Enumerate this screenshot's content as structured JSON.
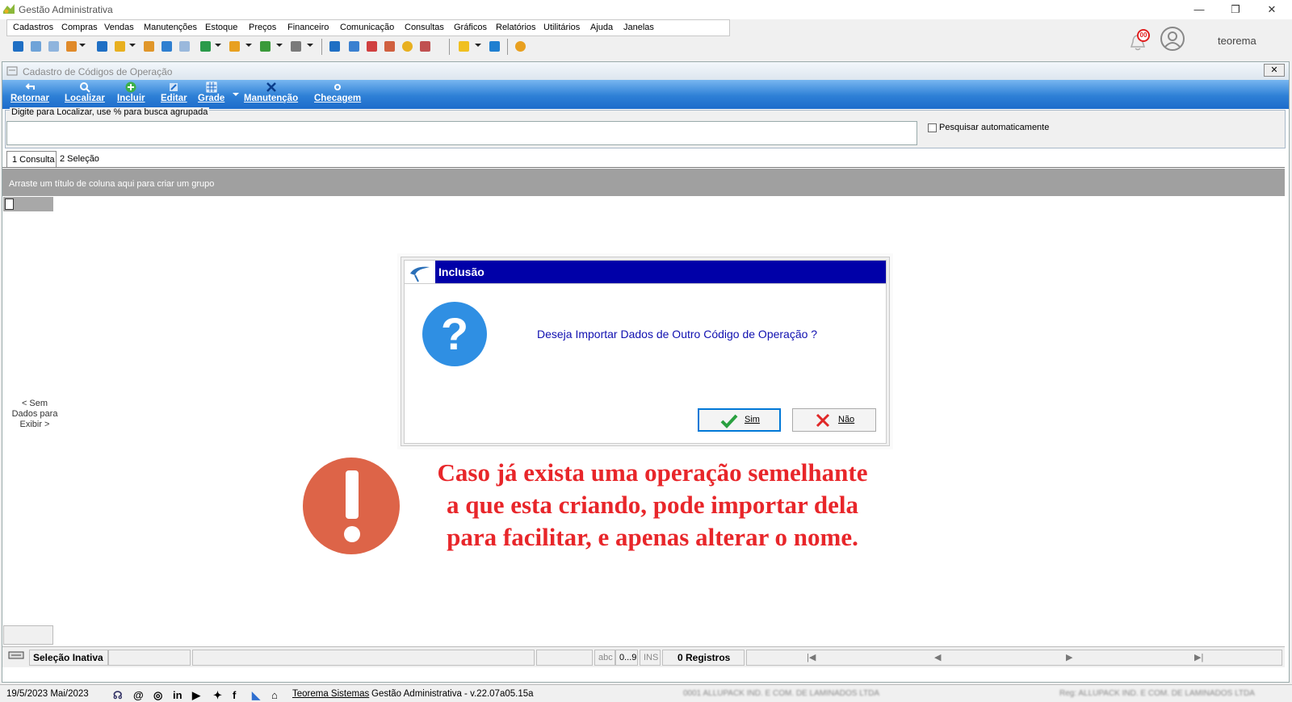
{
  "window": {
    "title": "Gestão Administrativa",
    "controls": {
      "minimize": "—",
      "restore": "❐",
      "close": "✕"
    }
  },
  "menu": [
    "Cadastros",
    "Compras",
    "Vendas",
    "Manutenções",
    "Estoque",
    "Preços",
    "Financeiro",
    "Comunicação",
    "Consultas",
    "Gráficos",
    "Relatórios",
    "Utilitários",
    "Ajuda",
    "Janelas"
  ],
  "header": {
    "notification_count": "00",
    "username": "teorema"
  },
  "form": {
    "title": "Cadastro de Códigos de Operação",
    "close": "✕",
    "ribbon": [
      "Retornar",
      "Localizar",
      "Incluir",
      "Editar",
      "Grade",
      "Manutenção",
      "Checagem"
    ],
    "search_legend": "Digite para Localizar, use % para busca agrupada",
    "search_value": "",
    "auto_search_label": "Pesquisar automaticamente",
    "tabs": [
      "1 Consulta",
      "2 Seleção"
    ],
    "group_hint": "Arraste um título de coluna aqui para criar um grupo",
    "no_data": "< Sem Dados para Exibir >"
  },
  "statusbar": {
    "selection": "Seleção Inativa",
    "abc": "abc",
    "digits": "0...9",
    "ins": "INS",
    "records": "0 Registros",
    "nav": [
      "|◀",
      "◀",
      "▶",
      "▶|"
    ]
  },
  "bottombar": {
    "date": "19/5/2023 Mai/2023",
    "company_link": "Teorema Sistemas",
    "version": "Gestão Administrativa - v.22.07a05.15a",
    "company_name": "0001 ALLUPACK IND. E COM. DE LAMINADOS LTDA",
    "registered": "Reg: ALLUPACK IND. E COM. DE LAMINADOS LTDA"
  },
  "dialog": {
    "title": "Inclusão",
    "message": "Deseja Importar Dados de Outro Código de Operação ?",
    "yes_label": "Sim",
    "no_label": "Não"
  },
  "annotation": {
    "line1": "Caso já exista uma operação semelhante",
    "line2": "a que esta criando, pode importar dela",
    "line3": "para facilitar, e apenas alterar o nome."
  },
  "colors": {
    "ribbon": "#2e80d6",
    "dialog_title": "#0000a8",
    "annotation": "#e8262a",
    "warning": "#dd6448",
    "question": "#2f8fe3"
  }
}
